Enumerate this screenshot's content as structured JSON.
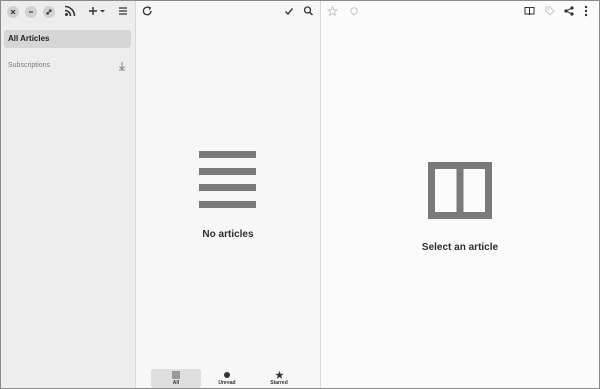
{
  "sidebar": {
    "nav_all_label": "All Articles",
    "subscriptions_label": "Subscriptions"
  },
  "article_list": {
    "empty_text": "No articles",
    "tabs": [
      {
        "label": "All",
        "icon": "list-icon",
        "active": true
      },
      {
        "label": "Unread",
        "icon": "dot-icon",
        "active": false
      },
      {
        "label": "Starred",
        "icon": "star-icon",
        "active": false
      }
    ]
  },
  "content": {
    "empty_text": "Select an article"
  },
  "colors": {
    "sidebar_bg": "#ededed",
    "list_bg": "#f7f7f7",
    "selected_bg": "#d6d6d6",
    "placeholder_icon": "#7a7a7a"
  }
}
